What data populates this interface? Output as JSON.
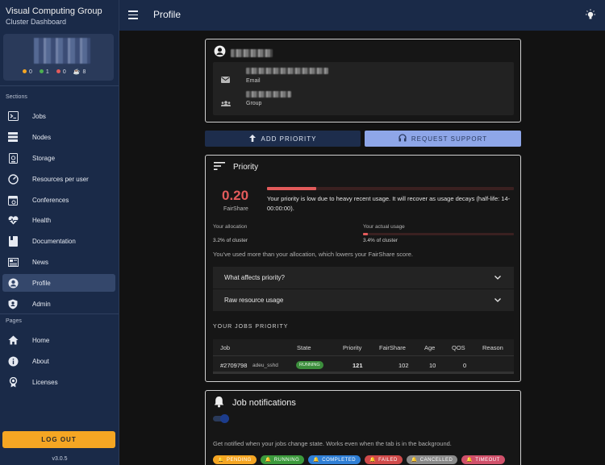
{
  "brand": {
    "title": "Visual Computing Group",
    "subtitle": "Cluster Dashboard"
  },
  "user_card": {
    "counts": [
      {
        "color": "#f5a623",
        "value": "0"
      },
      {
        "color": "#4caf50",
        "value": "1"
      },
      {
        "color": "#e35b5b",
        "value": "0"
      },
      {
        "icon": "coffee-icon",
        "value": "8"
      }
    ]
  },
  "sidebar": {
    "sections_label": "Sections",
    "items": [
      {
        "label": "Jobs",
        "icon": "terminal-icon"
      },
      {
        "label": "Nodes",
        "icon": "server-icon"
      },
      {
        "label": "Storage",
        "icon": "storage-icon"
      },
      {
        "label": "Resources per user",
        "icon": "speedometer-icon"
      },
      {
        "label": "Conferences",
        "icon": "calendar-icon"
      },
      {
        "label": "Health",
        "icon": "heartbeat-icon"
      },
      {
        "label": "Documentation",
        "icon": "book-icon"
      },
      {
        "label": "News",
        "icon": "newspaper-icon"
      },
      {
        "label": "Profile",
        "icon": "account-circle-icon",
        "active": true
      },
      {
        "label": "Admin",
        "icon": "shield-icon"
      }
    ],
    "pages_label": "Pages",
    "pages": [
      {
        "label": "Home",
        "icon": "home-icon"
      },
      {
        "label": "About",
        "icon": "info-icon"
      },
      {
        "label": "Licenses",
        "icon": "license-icon"
      }
    ],
    "logout_label": "LOG OUT",
    "version": "v3.0.5"
  },
  "topbar": {
    "title": "Profile"
  },
  "profile": {
    "email_label": "Email",
    "group_label": "Group"
  },
  "buttons": {
    "add_priority": "ADD PRIORITY",
    "request_support": "REQUEST SUPPORT"
  },
  "priority": {
    "title": "Priority",
    "score": "0.20",
    "score_label": "FairShare",
    "score_fraction": 0.2,
    "message": "Your priority is low due to heavy recent usage. It will recover as usage decays (half-life: 14-00:00:00).",
    "allocation_label": "Your allocation",
    "allocation_value": "3.2% of cluster",
    "actual_label": "Your actual usage",
    "actual_value": "3.4% of cluster",
    "actual_fraction": 0.034,
    "note": "You've used more than your allocation, which lowers your FairShare score.",
    "accordions": [
      "What affects priority?",
      "Raw resource usage"
    ],
    "jobs_title": "YOUR JOBS PRIORITY",
    "columns": [
      "Job",
      "State",
      "Priority",
      "FairShare",
      "Age",
      "QOS",
      "Reason"
    ],
    "rows": [
      {
        "job": "#2709798",
        "name": "adeu_sshd",
        "state": "RUNNING",
        "priority": "121",
        "fairshare": "102",
        "age": "10",
        "qos": "0",
        "reason": ""
      }
    ]
  },
  "notifications": {
    "title": "Job notifications",
    "description": "Get notified when your jobs change state. Works even when the tab is in the background.",
    "chips": [
      {
        "label": "PENDING",
        "color": "#f5a623"
      },
      {
        "label": "RUNNING",
        "color": "#3c9a3c"
      },
      {
        "label": "COMPLETED",
        "color": "#2f7fd6"
      },
      {
        "label": "FAILED",
        "color": "#d04a4a"
      },
      {
        "label": "CANCELLED",
        "color": "#8a8a8a"
      },
      {
        "label": "TIMEOUT",
        "color": "#d0506a"
      }
    ]
  }
}
